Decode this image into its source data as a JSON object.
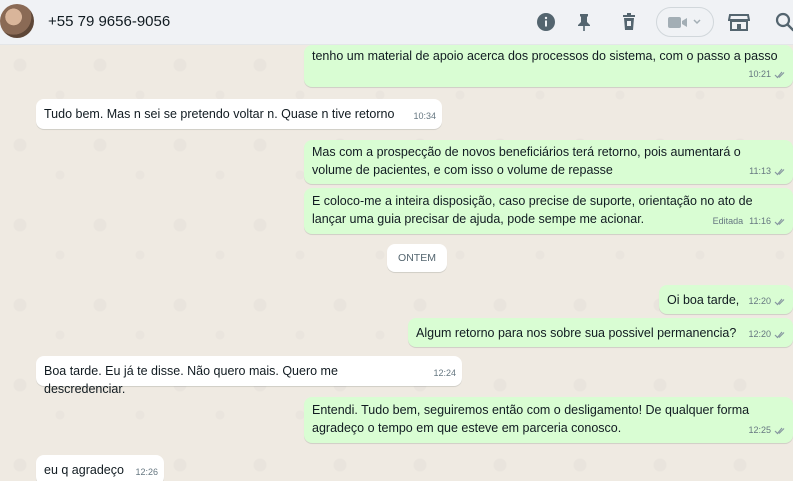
{
  "header": {
    "contact_name": "+55 79 9656-9056",
    "icons": [
      "info-icon",
      "pin-icon",
      "trash-icon",
      "video-call-icon",
      "chevron-down-icon",
      "store-icon",
      "search-icon"
    ]
  },
  "chat": {
    "date_separator": "ONTEM",
    "messages": [
      {
        "direction": "out",
        "text": "tenho um material de apoio acerca dos processos do sistema, com o passo a passo",
        "time": "10:21",
        "status": "read"
      },
      {
        "direction": "in",
        "text": "Tudo bem. Mas n sei se pretendo voltar n. Quase n tive retorno",
        "time": "10:34"
      },
      {
        "direction": "out",
        "text": "Mas com a prospecção de novos beneficiários terá retorno, pois aumentará o volume de pacientes, e com isso o volume de repasse",
        "time": "11:13",
        "status": "read"
      },
      {
        "direction": "out",
        "text": "E coloco-me a inteira disposição, caso precise de suporte, orientação no ato de lançar uma guia precisar de ajuda, pode sempe me acionar.",
        "edited": "Editada",
        "time": "11:16",
        "status": "read"
      },
      {
        "direction": "out",
        "text": "Oi boa tarde,",
        "time": "12:20",
        "status": "read"
      },
      {
        "direction": "out",
        "text": "Algum retorno para nos sobre sua possivel permanencia?",
        "time": "12:20",
        "status": "read"
      },
      {
        "direction": "in",
        "text": "Boa tarde. Eu já te disse. Não quero mais. Quero me descredenciar.",
        "time": "12:24"
      },
      {
        "direction": "out",
        "text": "Entendi. Tudo bem, seguiremos então com o desligamento! De qualquer forma agradeço o tempo em que esteve em parceria conosco.",
        "time": "12:25",
        "status": "read"
      },
      {
        "direction": "in",
        "text": "eu q agradeço",
        "time": "12:26"
      }
    ]
  },
  "colors": {
    "outgoing_bubble": "#d9fdd3",
    "incoming_bubble": "#ffffff",
    "read_ticks": "#8696a0",
    "chat_background": "#efeae2"
  }
}
